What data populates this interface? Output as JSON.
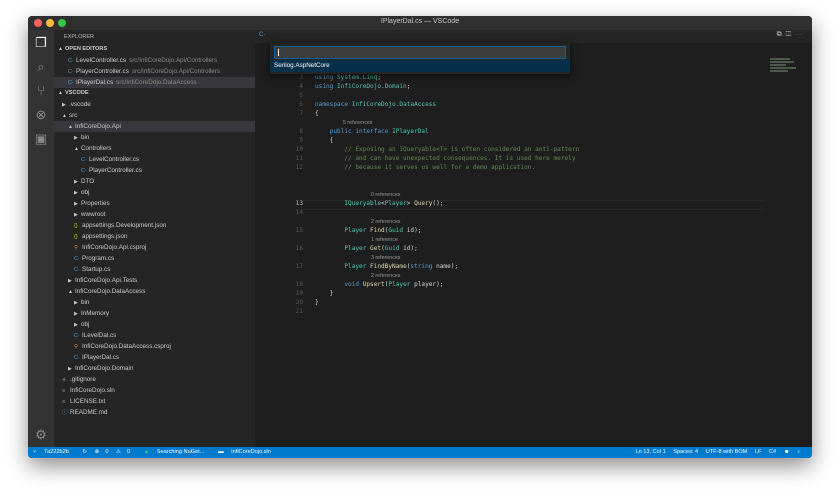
{
  "window": {
    "title": "IPlayerDal.cs — VSCode"
  },
  "sidebar": {
    "header": "EXPLORER",
    "open_editors_label": "OPEN EDITORS",
    "open_editors": [
      {
        "name": "LevelController.cs",
        "path": "src/InfiCoreDojo.Api/Controllers"
      },
      {
        "name": "PlayerController.cs",
        "path": "src/InfiCoreDojo.Api/Controllers"
      },
      {
        "name": "IPlayerDal.cs",
        "path": "src/InfiCoreDojo.DataAccess"
      }
    ],
    "workspace_label": "VSCODE",
    "tree": [
      {
        "label": ".vscode"
      },
      {
        "label": "src"
      },
      {
        "label": "InfiCoreDojo.Api"
      },
      {
        "label": "bin"
      },
      {
        "label": "Controllers"
      },
      {
        "label": "LevelController.cs"
      },
      {
        "label": "PlayerController.cs"
      },
      {
        "label": "DTO"
      },
      {
        "label": "obj"
      },
      {
        "label": "Properties"
      },
      {
        "label": "wwwroot"
      },
      {
        "label": "appsettings.Development.json"
      },
      {
        "label": "appsettings.json"
      },
      {
        "label": "InfiCoreDojo.Api.csproj"
      },
      {
        "label": "Program.cs"
      },
      {
        "label": "Startup.cs"
      },
      {
        "label": "InfiCoreDojo.Api.Tests"
      },
      {
        "label": "InfiCoreDojo.DataAccess"
      },
      {
        "label": "bin"
      },
      {
        "label": "InMemory"
      },
      {
        "label": "obj"
      },
      {
        "label": "ILevelDal.cs"
      },
      {
        "label": "InfiCoreDojo.DataAccess.csproj"
      },
      {
        "label": "IPlayerDal.cs"
      },
      {
        "label": "InfiCoreDojo.Domain"
      },
      {
        "label": ".gitignore"
      },
      {
        "label": "InfiCoreDojo.sln"
      },
      {
        "label": "LICENSE.txt"
      },
      {
        "label": "README.md"
      }
    ]
  },
  "quick_pick": {
    "value": "",
    "item": "Serilog.AspNetCore"
  },
  "editor": {
    "line_numbers": [
      "3",
      "4",
      "5",
      "6",
      "7",
      "8",
      "9",
      "10",
      "11",
      "12",
      "13",
      "14",
      "15",
      "16",
      "17",
      "18",
      "19",
      "20",
      "21"
    ],
    "lens": [
      "5 references",
      "0 references",
      "2 references",
      "1 reference",
      "3 references",
      "2 references"
    ],
    "tokens": {
      "using": "using",
      "system_linq": "System.Linq",
      "domain_ns": "InfiCoreDojo.Domain",
      "namespace": "namespace",
      "dataaccess_ns": "InfiCoreDojo.DataAccess",
      "public": "public",
      "interface": "interface",
      "iplayerdal": "IPlayerDal",
      "comment1": "// Exposing an IQueryable<T> is often considered an anti-pattern",
      "comment2": "// and can have unexpected consequences. It is used here merely",
      "comment3": "// because it serves us well for a demo application.",
      "iqueryable": "IQueryable",
      "player": "Player",
      "query": "Query",
      "find": "Find",
      "get": "Get",
      "guid": "Guid",
      "id": "id",
      "findbyname": "FindByName",
      "string": "string",
      "name": "name",
      "void": "void",
      "upsert": "Upsert",
      "player_param": "player"
    }
  },
  "status": {
    "branch": "7a222b2b",
    "errors": "0",
    "warnings": "0",
    "task": "Searching NuGet...",
    "solution": "InfiCoreDojo.sln",
    "position": "Ln 13, Col 1",
    "spaces": "Spaces: 4",
    "encoding": "UTF-8 with BOM",
    "eol": "LF",
    "language": "C#"
  }
}
